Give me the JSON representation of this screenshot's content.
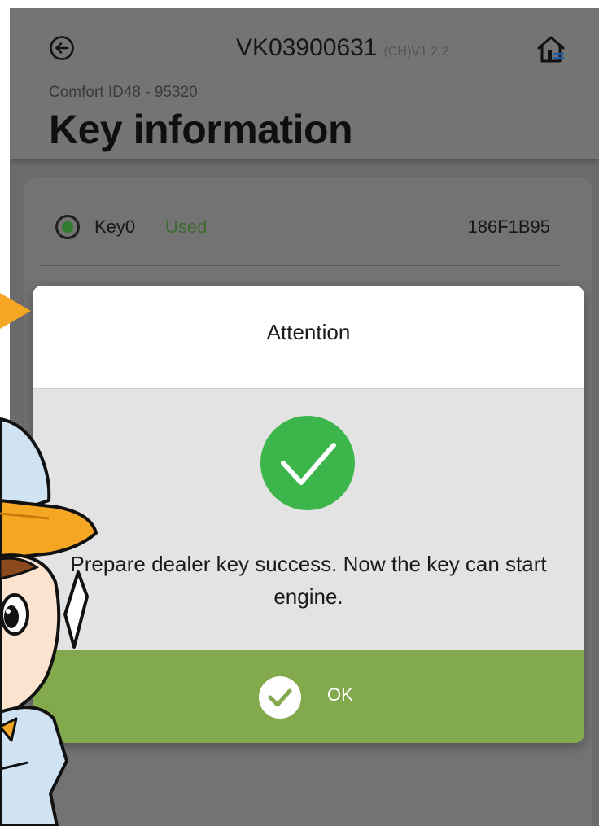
{
  "header": {
    "device_id": "VK03900631",
    "version": "(CH)V1.2.2",
    "subtitle": "Comfort ID48 - 95320",
    "title": "Key information",
    "back_icon": "back-arrow-circle-icon",
    "home_icon": "home-icon"
  },
  "key_list": {
    "items": [
      {
        "name": "Key0",
        "status": "Used",
        "code": "186F1B95",
        "selected": true
      }
    ]
  },
  "dialog": {
    "title": "Attention",
    "icon": "success-check-icon",
    "message": "Prepare dealer key success. Now the key can start engine.",
    "ok_label": "OK",
    "ok_icon": "check-circle-icon"
  },
  "colors": {
    "success_green": "#3cb54a",
    "ok_button_bg": "#82a94b",
    "status_used": "#3d6b2f",
    "radio_dot": "#2e7d2e",
    "pointer_orange": "#f5a623"
  }
}
